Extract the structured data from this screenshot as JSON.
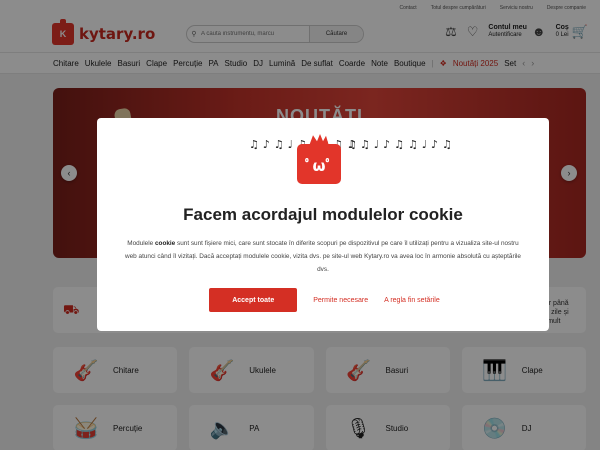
{
  "topbar": {
    "links": [
      "Contact",
      "Totul despre cumpărături",
      "Serviciu nostru",
      "Despre companie"
    ]
  },
  "header": {
    "logo_badge": "K",
    "logo_text": "kytary.ro",
    "search_placeholder": "A căuta instrumentu, marcu",
    "search_button": "Căutare",
    "account_title": "Contul meu",
    "account_sub": "Autentificare",
    "cart_title": "Coș",
    "cart_sub": "0 Lei"
  },
  "nav": {
    "items": [
      "Chitare",
      "Ukulele",
      "Basuri",
      "Clape",
      "Percuție",
      "PA",
      "Studio",
      "DJ",
      "Lumină",
      "De suflat",
      "Coarde",
      "Note",
      "Boutique"
    ],
    "highlight": "Noutăți 2025",
    "more": "Set"
  },
  "banner": {
    "title": "NOUTĂȚI"
  },
  "infostrip": {
    "right_text": "Retur până la 30 zile și mai mult"
  },
  "categories": [
    {
      "label": "Chitare",
      "icon": "acoustic-guitar"
    },
    {
      "label": "Ukulele",
      "icon": "ukulele"
    },
    {
      "label": "Basuri",
      "icon": "bass-guitar"
    },
    {
      "label": "Clape",
      "icon": "grand-piano"
    },
    {
      "label": "Percuție",
      "icon": "drum-kit"
    },
    {
      "label": "PA",
      "icon": "speaker"
    },
    {
      "label": "Studio",
      "icon": "microphone"
    },
    {
      "label": "DJ",
      "icon": "turntable"
    }
  ],
  "cookie_modal": {
    "title": "Facem acordajul modulelor cookie",
    "desc_prefix": "Modulele ",
    "desc_bold": "cookie",
    "desc_rest": " sunt sunt fișiere mici, care sunt stocate în diferite scopuri pe dispozitivul pe care îl utilizați pentru a vizualiza site-ul nostru web atunci când îl vizitați. Dacă acceptați modulele cookie, vizita dvs. pe site-ul web Kytary.ro va avea loc în armonie absolută cu așteptările dvs.",
    "accept_label": "Accept toate",
    "necessary_label": "Permite necesare",
    "settings_label": "A regla fin setările",
    "mascot_face": "ﾟωﾟ"
  },
  "colors": {
    "brand_red": "#e2352a",
    "button_red": "#d42f24"
  }
}
